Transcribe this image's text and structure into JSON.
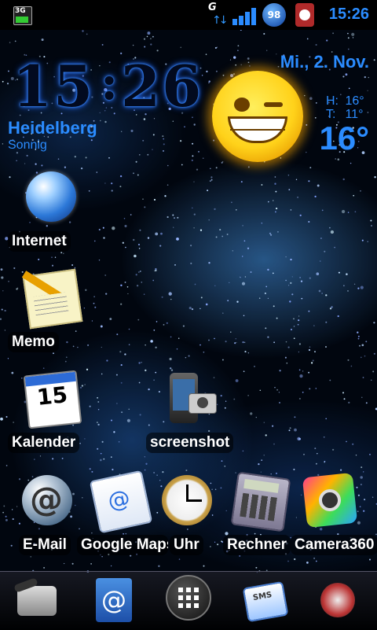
{
  "status_bar": {
    "network_label": "3G",
    "data_label": "G",
    "battery_level": "98",
    "time": "15:26",
    "colors": {
      "accent": "#2b8cff",
      "bg": "#000000"
    }
  },
  "weather_widget": {
    "time_hours": "15",
    "time_minutes": "26",
    "date": "Mi., 2. Nov.",
    "city": "Heidelberg",
    "condition": "Sonnig",
    "high_label": "H:",
    "high_value": "16°",
    "low_label": "T:",
    "low_value": "11°",
    "current_temp": "16°",
    "icon": "sun-smiley-icon",
    "accent": "#2b8cff"
  },
  "shortcuts": [
    {
      "label": "Internet",
      "icon": "globe-icon"
    },
    {
      "label": "Memo",
      "icon": "memo-icon"
    },
    {
      "label": "Kalender",
      "icon": "calendar-icon",
      "icon_text": "15"
    },
    {
      "label": "screenshot",
      "icon": "screenshot-icon"
    },
    {
      "label": "E-Mail",
      "icon": "email-icon"
    },
    {
      "label": "Google Maps",
      "icon": "google-maps-icon"
    },
    {
      "label": "Uhr",
      "icon": "clock-icon"
    },
    {
      "label": "Rechner",
      "icon": "calculator-icon"
    },
    {
      "label": "Camera360",
      "icon": "camera360-icon"
    }
  ],
  "dock": {
    "items": [
      {
        "name": "phone",
        "icon": "phone-icon"
      },
      {
        "name": "contacts",
        "icon": "contacts-icon"
      },
      {
        "name": "app-drawer",
        "icon": "app-drawer-icon"
      },
      {
        "name": "messaging",
        "icon": "sms-icon",
        "text": "SMS"
      },
      {
        "name": "media",
        "icon": "media-icon"
      }
    ]
  }
}
